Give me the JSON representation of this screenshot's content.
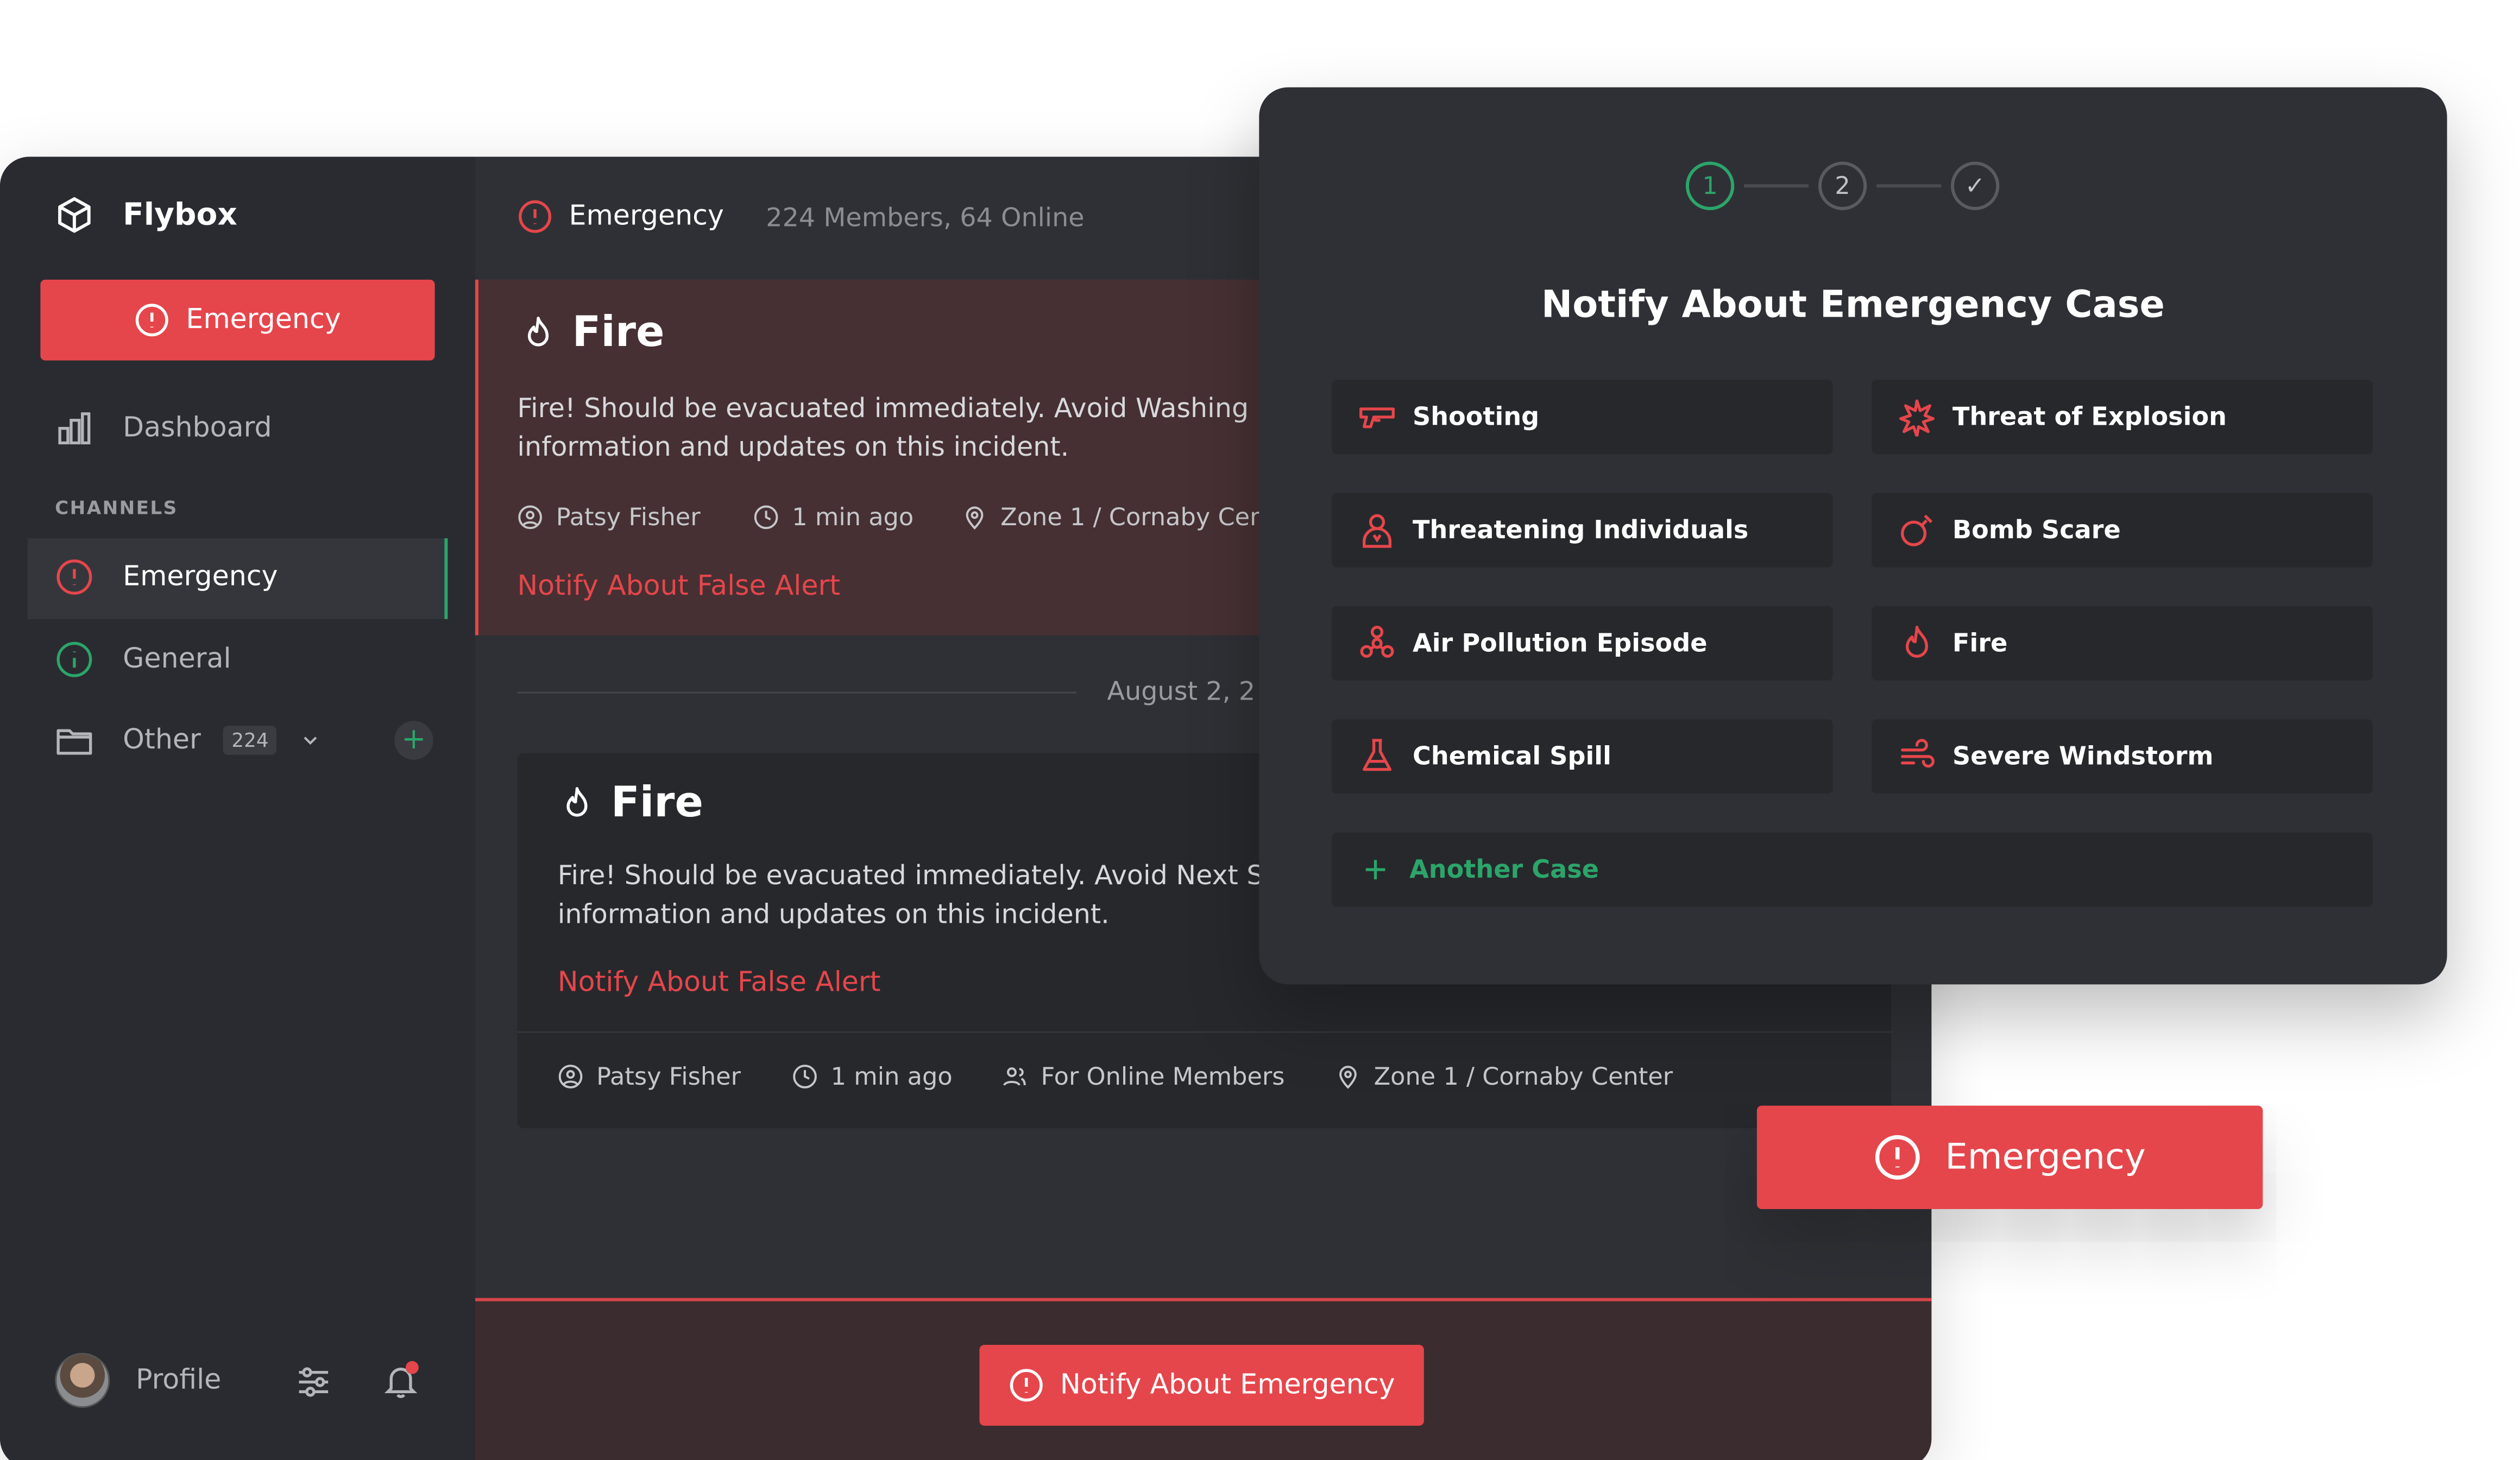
{
  "app": {
    "name": "Flybox",
    "brand_color": "#e5464b",
    "accent_green": "#2ba56a"
  },
  "sidebar": {
    "emergency_button": "Emergency",
    "dashboard_label": "Dashboard",
    "channels_label": "CHANNELS",
    "channels": [
      {
        "label": "Emergency",
        "icon": "alert-circle-icon"
      },
      {
        "label": "General",
        "icon": "info-circle-icon"
      },
      {
        "label": "Other",
        "badge": "224",
        "icon": "folder-icon"
      }
    ],
    "profile_label": "Profile"
  },
  "header": {
    "channel_title": "Emergency",
    "meta": "224 Members, 64 Online"
  },
  "feed": {
    "card1": {
      "title": "Fire",
      "text_line1": "Fire! Should be evacuated immediately. Avoid Washing",
      "text_line2": "information and updates on this incident.",
      "author": "Patsy Fisher",
      "time": "1 min ago",
      "location": "Zone 1 / Cornaby Cent",
      "action": "Notify About False Alert"
    },
    "date_separator": "August 2, 2",
    "card2": {
      "title": "Fire",
      "text_line1": "Fire! Should be evacuated immediately. Avoid Next S",
      "text_line2": "information and updates on this incident.",
      "action": "Notify About False Alert",
      "author": "Patsy Fisher",
      "time": "1 min ago",
      "audience": "For Online Members",
      "location": "Zone 1 / Cornaby Center"
    }
  },
  "bottom_bar": {
    "notify_button": "Notify About Emergency"
  },
  "modal": {
    "steps": [
      "1",
      "2",
      "✓"
    ],
    "title": "Notify About Emergency Case",
    "cases": [
      {
        "label": "Shooting",
        "icon": "gun-icon"
      },
      {
        "label": "Threat of Explosion",
        "icon": "explosion-icon"
      },
      {
        "label": "Threatening Individuals",
        "icon": "person-icon"
      },
      {
        "label": "Bomb Scare",
        "icon": "bomb-icon"
      },
      {
        "label": "Air Pollution Episode",
        "icon": "biohazard-icon"
      },
      {
        "label": "Fire",
        "icon": "flame-icon"
      },
      {
        "label": "Chemical Spill",
        "icon": "flask-icon"
      },
      {
        "label": "Severe Windstorm",
        "icon": "wind-icon"
      }
    ],
    "another_case": "Another Case"
  },
  "floating_button": "Emergency"
}
